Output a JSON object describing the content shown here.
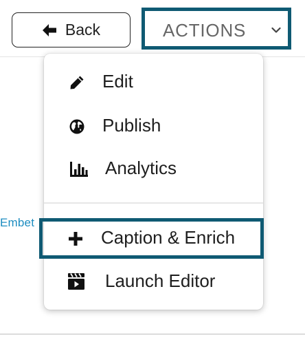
{
  "toolbar": {
    "back_label": "Back",
    "actions_label": "ACTIONS"
  },
  "background": {
    "edge_text": "Embet"
  },
  "menu": {
    "items": [
      {
        "label": "Edit",
        "icon": "pencil-icon"
      },
      {
        "label": "Publish",
        "icon": "globe-icon"
      },
      {
        "label": "Analytics",
        "icon": "bar-chart-icon"
      },
      {
        "label": "Caption & Enrich",
        "icon": "plus-icon"
      },
      {
        "label": "Launch Editor",
        "icon": "clapperboard-icon"
      }
    ]
  },
  "colors": {
    "highlight": "#0f5a73",
    "link": "#1c8cc0",
    "text": "#1e1e1e"
  }
}
